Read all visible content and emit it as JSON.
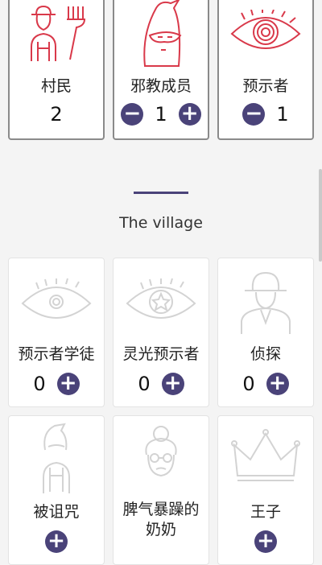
{
  "selected_roles": [
    {
      "name": "村民",
      "count": "2"
    },
    {
      "name": "邪教成员",
      "count": "1"
    },
    {
      "name": "预示者",
      "count": "1"
    }
  ],
  "section_title": "The village",
  "village_roles": [
    {
      "name": "预示者学徒",
      "count": "0"
    },
    {
      "name": "灵光预示者",
      "count": "0"
    },
    {
      "name": "侦探",
      "count": "0"
    },
    {
      "name": "被诅咒",
      "count": ""
    },
    {
      "name": "脾气暴躁的\n奶奶",
      "count": ""
    },
    {
      "name": "王子",
      "count": ""
    }
  ],
  "colors": {
    "accent": "#4a4379",
    "art_selected": "#d9394a",
    "art_unselected": "#d3d3d3"
  }
}
